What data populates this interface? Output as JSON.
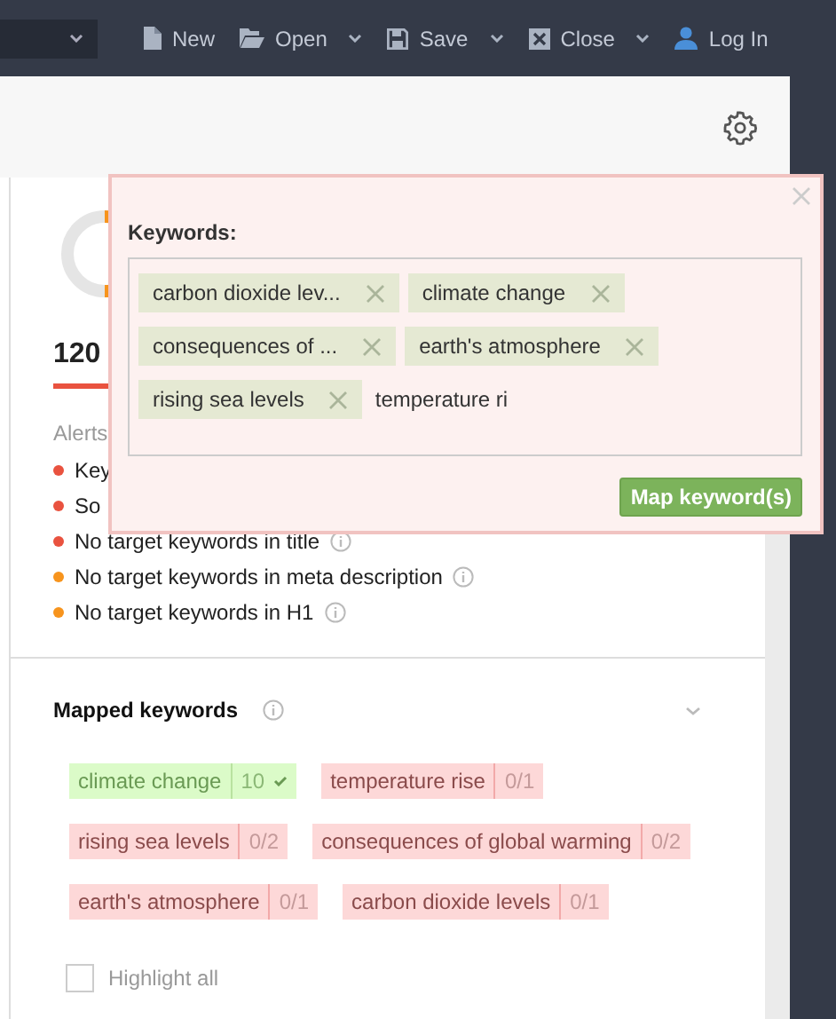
{
  "toolbar": {
    "items": [
      {
        "label": "New",
        "kind": "file",
        "has_menu": false
      },
      {
        "label": "Open",
        "kind": "folder",
        "has_menu": true
      },
      {
        "label": "Save",
        "kind": "disk",
        "has_menu": true
      },
      {
        "label": "Close",
        "kind": "close",
        "has_menu": true
      },
      {
        "label": "Log In",
        "kind": "user",
        "has_menu": false
      }
    ]
  },
  "score": {
    "value": "120"
  },
  "alerts": {
    "title": "Alerts",
    "items": [
      {
        "text": "Key",
        "color": "#e9523f",
        "has_info": false
      },
      {
        "text": "So",
        "color": "#e9523f",
        "has_info": false
      },
      {
        "text": "No target keywords in title",
        "color": "#e9523f",
        "has_info": true
      },
      {
        "text": "No target keywords in meta description",
        "color": "#f7941d",
        "has_info": true
      },
      {
        "text": "No target keywords in H1",
        "color": "#f7941d",
        "has_info": true
      }
    ]
  },
  "keywords_popup": {
    "label": "Keywords:",
    "tags": [
      {
        "text": "carbon dioxide lev..."
      },
      {
        "text": "climate change"
      },
      {
        "text": "consequences of ..."
      },
      {
        "text": "earth's atmosphere"
      },
      {
        "text": "rising sea levels"
      }
    ],
    "input_value": "temperature ri",
    "button": "Map keyword(s)"
  },
  "mapped_keywords": {
    "title": "Mapped keywords",
    "keywords": [
      {
        "text": "climate change",
        "count": "10",
        "matched": true
      },
      {
        "text": "temperature rise",
        "count": "0/1",
        "matched": false
      },
      {
        "text": "rising sea levels",
        "count": "0/2",
        "matched": false
      },
      {
        "text": "consequences of global warming",
        "count": "0/2",
        "matched": false
      },
      {
        "text": "earth's atmosphere",
        "count": "0/1",
        "matched": false
      },
      {
        "text": "carbon dioxide levels",
        "count": "0/1",
        "matched": false
      }
    ],
    "highlight_all": {
      "label": "Highlight all",
      "checked": false
    }
  }
}
